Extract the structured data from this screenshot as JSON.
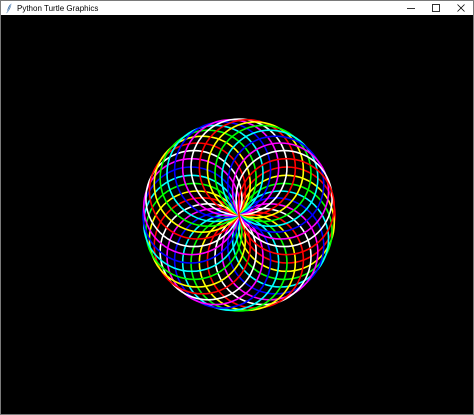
{
  "window": {
    "title": "Python Turtle Graphics",
    "icon": "feather-icon",
    "controls": [
      "minimize-icon",
      "maximize-icon",
      "close-icon"
    ]
  },
  "canvas": {
    "background": "#000000",
    "pattern": "spirograph-circles",
    "palette": [
      "#ff0000",
      "#ffff00",
      "#00ff00",
      "#00ffff",
      "#0000ff",
      "#ff00ff",
      "#ffffff"
    ]
  }
}
